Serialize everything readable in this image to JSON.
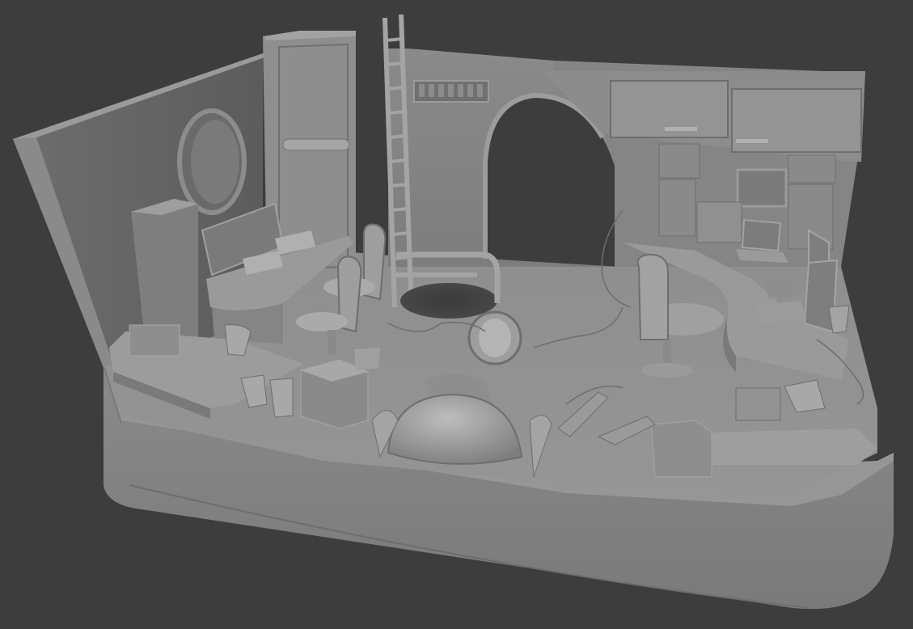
{
  "scene": {
    "background_color": "#3d3d3d",
    "material_color": "#8c8c8c",
    "shadow_color": "#5a5a5a",
    "highlight_color": "#a8a8a8",
    "description_icons": [
      "render-viewport"
    ]
  }
}
